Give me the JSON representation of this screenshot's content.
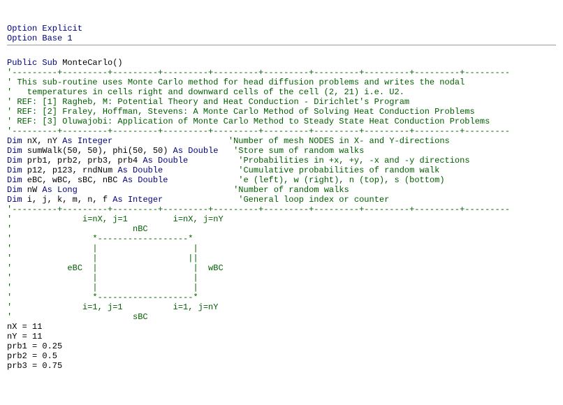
{
  "l01": "Option Explicit",
  "l02": "Option Base 1",
  "l03": "Public Sub",
  "l03b": " MonteCarlo()",
  "c00": "'---------+---------+---------+---------+---------+---------+---------+---------+---------+---------",
  "c01": "' This sub-routine uses Monte Carlo method for head diffusion problems and writes the nodal",
  "c02": "'   temperatures in cells right and downward cells of the cell (2, 21) i.e. U2.",
  "c03": "' REF: [1] Ragheb, M: Potential Theory and Heat Conduction - Dirichlet's Program",
  "c04": "' REF: [2] Fraley, Hoffman, Stevens: A Monte Carlo Method of Solving Heat Conduction Problems",
  "c05": "' REF: [3] Oluwajobi: Application of Monte Carlo Method to Steady State Heat Conduction Problems",
  "c06": "'---------+---------+---------+---------+---------+---------+---------+---------+---------+---------",
  "d1a": "Dim",
  "d1b": " nX, nY ",
  "d1c": "As Integer",
  "d1d": "                       ",
  "d1e": "'Number of mesh NODES in X- and Y-directions",
  "d2a": "Dim",
  "d2b": " sumWalk(50, 50), phi(50, 50) ",
  "d2c": "As Double",
  "d2d": "   ",
  "d2e": "'Store sum of random walks",
  "d3a": "Dim",
  "d3b": " prb1, prb2, prb3, prb4 ",
  "d3c": "As Double",
  "d3d": "          ",
  "d3e": "'Probabilities in +x, +y, -x and -y directions",
  "d4a": "Dim",
  "d4b": " p12, p123, rndNum ",
  "d4c": "As Double",
  "d4d": "               ",
  "d4e": "'Cumulative probabilities of random walk",
  "d5a": "Dim",
  "d5b": " eBC, wBC, sBC, nBC ",
  "d5c": "As Double",
  "d5d": "              ",
  "d5e": "'e (left), w (right), n (top), s (bottom)",
  "d6a": "Dim",
  "d6b": " nW ",
  "d6c": "As Long",
  "d6d": "                               ",
  "d6e": "'Number of random walks",
  "d7a": "Dim",
  "d7b": " i, j, k, m, n, f ",
  "d7c": "As Integer",
  "d7d": "               ",
  "d7e": "'General loop index or counter",
  "c07": "'---------+---------+---------+---------+---------+---------+---------+---------+---------+---------",
  "a01": "'              i=nX, j=1         i=nX, j=nY",
  "a02": "'                        nBC",
  "a03": "'                *------------------*",
  "a04": "'                |                   |",
  "a05": "'                |                  ||",
  "a06": "'           eBC  |                   |  wBC",
  "a07": "'                |                   |",
  "a08": "'                |                   |",
  "a09": "'                *-------------------*",
  "a10": "'              i=1, j=1          i=1, j=nY",
  "a11": "'                        sBC",
  "s1": "nX = 11",
  "s2": "nY = 11",
  "s3": "prb1 = 0.25",
  "s4": "prb2 = 0.5",
  "s5": "prb3 = 0.75"
}
